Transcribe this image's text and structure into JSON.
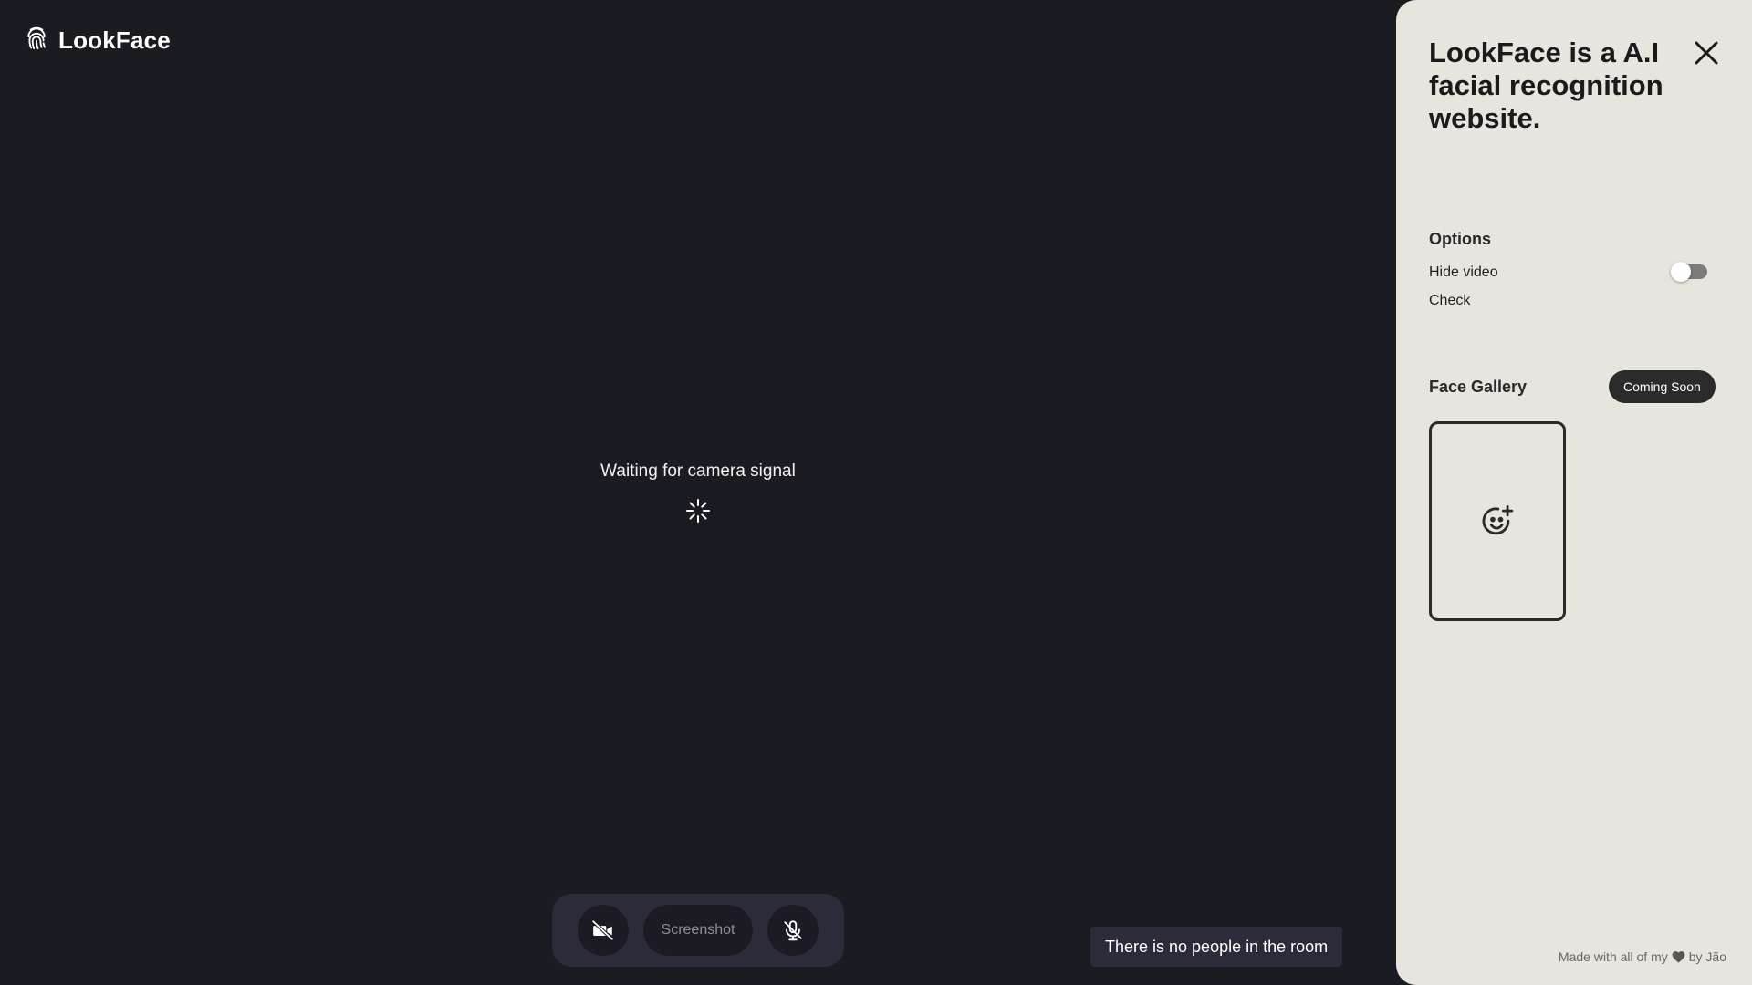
{
  "brand": {
    "name": "LookFace",
    "icon": "fingerprint-icon"
  },
  "stage": {
    "status_text": "Waiting for camera signal",
    "spinner_icon": "spinner-icon",
    "background": "#1b1b22"
  },
  "controls": {
    "camera_icon": "camera-off-icon",
    "screenshot_label": "Screenshot",
    "mic_icon": "mic-off-icon"
  },
  "toast": {
    "message": "There is no people in the room"
  },
  "panel": {
    "title": "LookFace is a A.I facial recognition website.",
    "close_icon": "close-icon",
    "background": "#e8e4de",
    "options": {
      "heading": "Options",
      "hide_video_label": "Hide video",
      "hide_video_enabled": false,
      "check_label": "Check"
    },
    "gallery": {
      "heading": "Face Gallery",
      "badge": "Coming Soon",
      "add_icon": "face-add-icon"
    },
    "footer": {
      "prefix": "Made with all of my",
      "heart_icon": "heart-icon",
      "suffix": "by Jão"
    }
  }
}
